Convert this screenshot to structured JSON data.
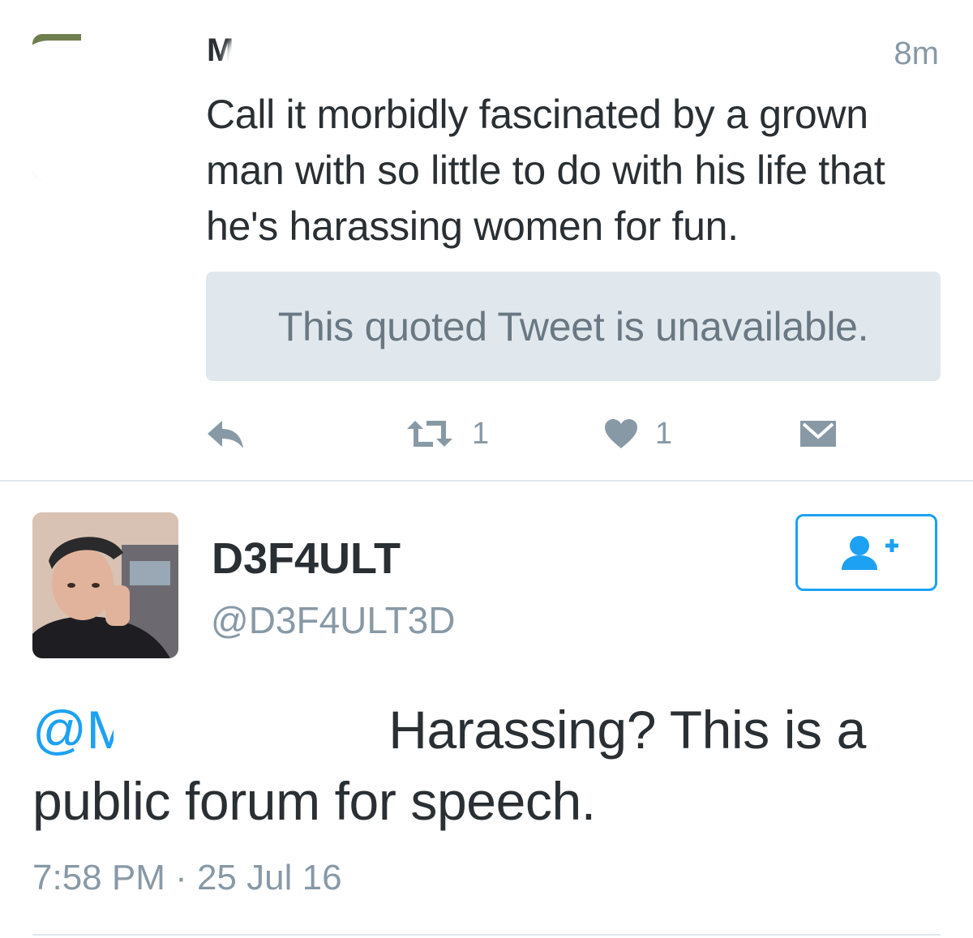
{
  "tweet1": {
    "author_name": "M",
    "time": "8m",
    "text": "Call it morbidly fascinated by a grown man with so little to do with his life that he's harassing women for fun.",
    "quoted_notice": "This quoted Tweet is unavailable.",
    "actions": {
      "reply_icon": "reply-icon",
      "retweet_icon": "retweet-icon",
      "retweet_count": "1",
      "like_icon": "heart-icon",
      "like_count": "1",
      "dm_icon": "envelope-icon"
    }
  },
  "tweet2": {
    "author_name": "D3F4ULT",
    "author_handle": "@D3F4ULT3D",
    "follow_icon": "add-user-icon",
    "mention": "@M",
    "text": "Harassing? This is a public forum for speech.",
    "timestamp": "7:58 PM · 25 Jul 16"
  },
  "colors": {
    "text": "#292f33",
    "muted": "#8899a6",
    "accent": "#1da1f2",
    "quote_bg": "#e1e8ed",
    "divider": "#e1e8ed"
  }
}
